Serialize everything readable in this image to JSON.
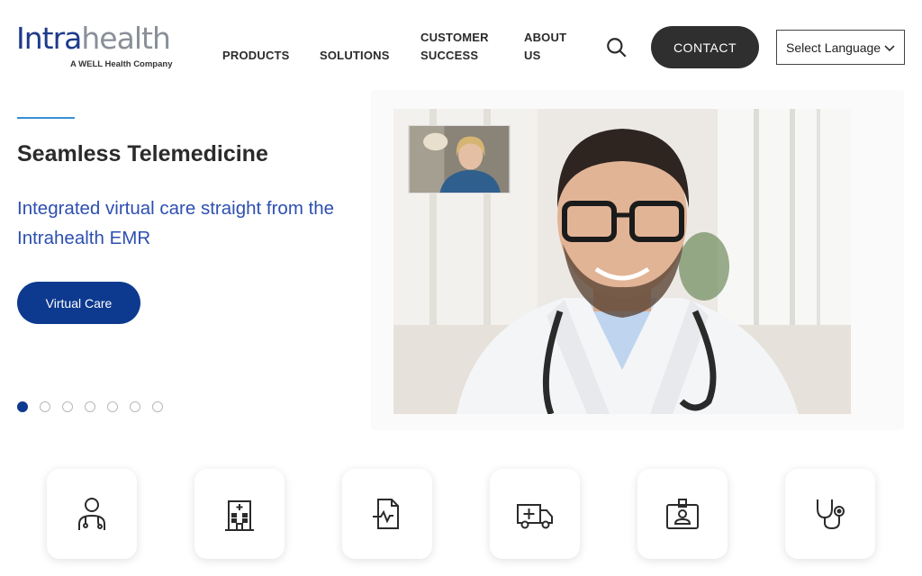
{
  "brand": {
    "logo_part1": "Intra",
    "logo_part2": "health",
    "tagline": "A WELL Health Company"
  },
  "nav": {
    "products": "PRODUCTS",
    "solutions": "SOLUTIONS",
    "customer_success": "CUSTOMER SUCCESS",
    "about_us": "ABOUT US",
    "contact": "CONTACT",
    "language": "Select Language"
  },
  "hero": {
    "title": "Seamless Telemedicine",
    "subtitle": "Integrated virtual care straight from the Intrahealth EMR",
    "cta": "Virtual Care",
    "slide_count": 7,
    "active_slide": 1
  },
  "feature_cards": [
    {
      "icon": "doctor-icon"
    },
    {
      "icon": "hospital-icon"
    },
    {
      "icon": "health-record-icon"
    },
    {
      "icon": "ambulance-icon"
    },
    {
      "icon": "id-badge-icon"
    },
    {
      "icon": "stethoscope-icon"
    }
  ],
  "colors": {
    "brand_blue": "#1e3a8a",
    "cta_blue": "#0d3a8f",
    "subtitle_blue": "#2d4fb0",
    "accent_line": "#3a8fd6",
    "contact_bg": "#2f2f2f"
  }
}
